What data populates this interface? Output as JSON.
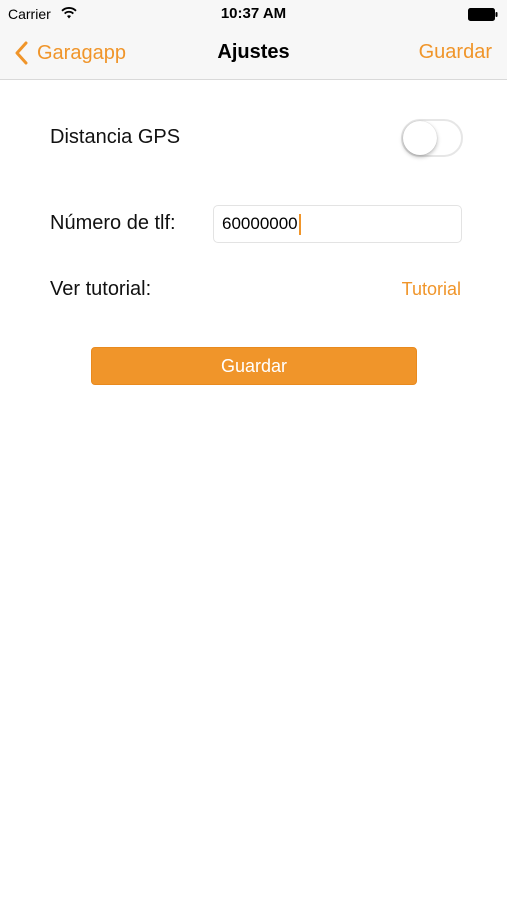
{
  "status_bar": {
    "carrier": "Carrier",
    "time": "10:37 AM",
    "icons": [
      "wifi-icon",
      "battery-icon"
    ]
  },
  "nav": {
    "back_label": "Garagapp",
    "title": "Ajustes",
    "save_label": "Guardar"
  },
  "settings": {
    "gps_label": "Distancia GPS",
    "gps_enabled": false,
    "phone_label": "Número de tlf:",
    "phone_value": "60000000",
    "tutorial_label": "Ver tutorial:",
    "tutorial_link": "Tutorial"
  },
  "save_button_label": "Guardar",
  "colors": {
    "accent": "#f0952a",
    "bar_background": "#f7f7f7"
  }
}
